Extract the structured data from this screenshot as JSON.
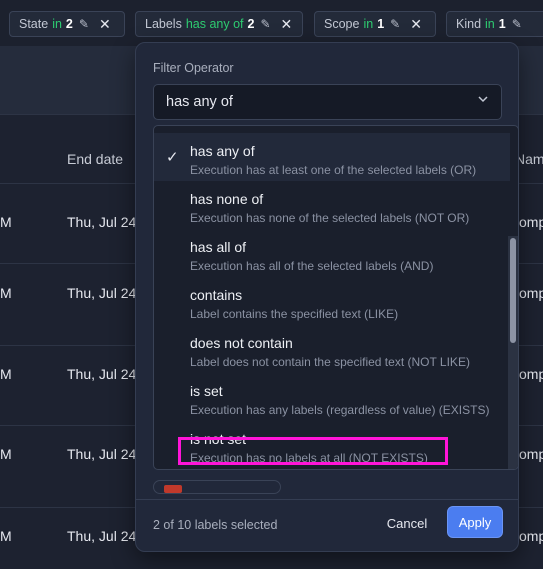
{
  "chips": [
    {
      "field": "State",
      "op": "in",
      "count": "2"
    },
    {
      "field": "Labels",
      "op": "has any of",
      "count": "2"
    },
    {
      "field": "Scope",
      "op": "in",
      "count": "1"
    },
    {
      "field": "Kind",
      "op": "in",
      "count": "1"
    }
  ],
  "table": {
    "headers": {
      "end_date": "End date",
      "name": "Nam"
    },
    "rows": [
      {
        "c1": "M",
        "end": "Thu, Jul 24",
        "name": "comp"
      },
      {
        "c1": "M",
        "end": "Thu, Jul 24",
        "name": "comp"
      },
      {
        "c1": "M",
        "end": "Thu, Jul 24",
        "name": "comp"
      },
      {
        "c1": "M",
        "end": "Thu, Jul 24",
        "name": "comp"
      },
      {
        "c1": "M",
        "end": "Thu, Jul 24",
        "name": "comp"
      }
    ]
  },
  "filter": {
    "label": "Filter Operator",
    "selected": "has any of",
    "options": [
      {
        "title": "has any of",
        "desc": "Execution has at least one of the selected labels (OR)",
        "checked": true
      },
      {
        "title": "has none of",
        "desc": "Execution has none of the selected labels (NOT OR)"
      },
      {
        "title": "has all of",
        "desc": "Execution has all of the selected labels (AND)"
      },
      {
        "title": "contains",
        "desc": "Label contains the specified text (LIKE)"
      },
      {
        "title": "does not contain",
        "desc": "Label does not contain the specified text (NOT LIKE)"
      },
      {
        "title": "is set",
        "desc": "Execution has any labels (regardless of value) (EXISTS)"
      },
      {
        "title": "is not set",
        "desc": "Execution has no labels at all (NOT EXISTS)"
      }
    ]
  },
  "footer": {
    "count": "2 of 10 labels selected",
    "cancel": "Cancel",
    "apply": "Apply"
  },
  "colors": {
    "accent": "#4b7df0",
    "op_green": "#2ecc71",
    "highlight": "#ff14d8"
  }
}
